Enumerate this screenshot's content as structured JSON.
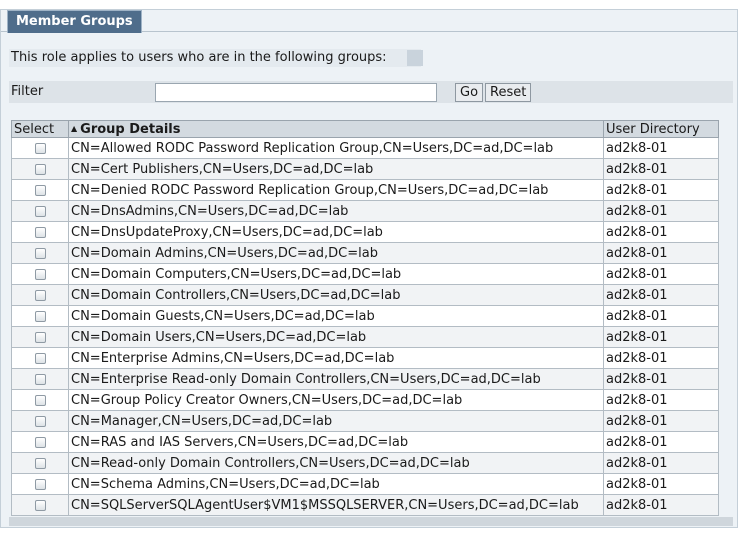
{
  "tab": {
    "title": "Member Groups"
  },
  "description": "This role applies to users who are in the following groups:",
  "filter": {
    "label": "Filter",
    "value": "",
    "placeholder": "",
    "go_label": "Go",
    "reset_label": "Reset"
  },
  "table": {
    "columns": {
      "select": "Select",
      "group_details": "Group Details",
      "user_directory": "User Directory"
    },
    "sort": {
      "column": "group_details",
      "direction": "ascending"
    },
    "rows": [
      {
        "group": "CN=Allowed RODC Password Replication Group,CN=Users,DC=ad,DC=lab",
        "directory": "ad2k8-01",
        "checked": false
      },
      {
        "group": "CN=Cert Publishers,CN=Users,DC=ad,DC=lab",
        "directory": "ad2k8-01",
        "checked": false
      },
      {
        "group": "CN=Denied RODC Password Replication Group,CN=Users,DC=ad,DC=lab",
        "directory": "ad2k8-01",
        "checked": false
      },
      {
        "group": "CN=DnsAdmins,CN=Users,DC=ad,DC=lab",
        "directory": "ad2k8-01",
        "checked": false
      },
      {
        "group": "CN=DnsUpdateProxy,CN=Users,DC=ad,DC=lab",
        "directory": "ad2k8-01",
        "checked": false
      },
      {
        "group": "CN=Domain Admins,CN=Users,DC=ad,DC=lab",
        "directory": "ad2k8-01",
        "checked": false
      },
      {
        "group": "CN=Domain Computers,CN=Users,DC=ad,DC=lab",
        "directory": "ad2k8-01",
        "checked": false
      },
      {
        "group": "CN=Domain Controllers,CN=Users,DC=ad,DC=lab",
        "directory": "ad2k8-01",
        "checked": false
      },
      {
        "group": "CN=Domain Guests,CN=Users,DC=ad,DC=lab",
        "directory": "ad2k8-01",
        "checked": false
      },
      {
        "group": "CN=Domain Users,CN=Users,DC=ad,DC=lab",
        "directory": "ad2k8-01",
        "checked": false
      },
      {
        "group": "CN=Enterprise Admins,CN=Users,DC=ad,DC=lab",
        "directory": "ad2k8-01",
        "checked": false
      },
      {
        "group": "CN=Enterprise Read-only Domain Controllers,CN=Users,DC=ad,DC=lab",
        "directory": "ad2k8-01",
        "checked": false
      },
      {
        "group": "CN=Group Policy Creator Owners,CN=Users,DC=ad,DC=lab",
        "directory": "ad2k8-01",
        "checked": false
      },
      {
        "group": "CN=Manager,CN=Users,DC=ad,DC=lab",
        "directory": "ad2k8-01",
        "checked": false
      },
      {
        "group": "CN=RAS and IAS Servers,CN=Users,DC=ad,DC=lab",
        "directory": "ad2k8-01",
        "checked": false
      },
      {
        "group": "CN=Read-only Domain Controllers,CN=Users,DC=ad,DC=lab",
        "directory": "ad2k8-01",
        "checked": false
      },
      {
        "group": "CN=Schema Admins,CN=Users,DC=ad,DC=lab",
        "directory": "ad2k8-01",
        "checked": false
      },
      {
        "group": "CN=SQLServerSQLAgentUser$VM1$MSSQLSERVER,CN=Users,DC=ad,DC=lab",
        "directory": "ad2k8-01",
        "checked": false
      }
    ]
  }
}
